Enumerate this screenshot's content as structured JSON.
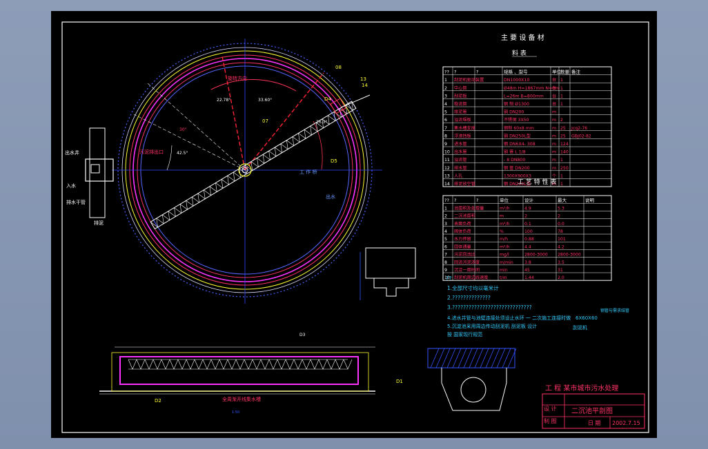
{
  "drawing": {
    "legend_labels": [
      "出水井",
      "入水",
      "排水干管",
      "排泥"
    ],
    "plan_labels": {
      "rotate_dir": "旋转方向",
      "sludge_outlet": "污泥排出口",
      "weir": "工 作 桥",
      "drain_pipe": "出水",
      "angle_a": "22.78°",
      "angle_b": "33.60°",
      "angle_c": "26.3°",
      "angle_d": "42.5°",
      "angle_e": "30°"
    },
    "callouts": [
      "08",
      "07",
      "D5",
      "D4",
      "D3",
      "D2",
      "D1",
      "14",
      "13",
      "15"
    ],
    "section_caption": "全周渐开线集水槽",
    "section_scale": "1:50"
  },
  "equipment_table": {
    "title": "主 要 设 备 材",
    "subtitle": "料 表",
    "headers": [
      "??",
      "?",
      "?",
      "规格 、型号",
      "单位",
      "数量",
      "备注"
    ],
    "rows": [
      [
        "1",
        "刮泥机驱动装置",
        "",
        "DN1000X10",
        "台",
        "1",
        ""
      ],
      [
        "2",
        "中心筒",
        "",
        "Ø48m H=1867mm N=0m",
        "台",
        "1",
        ""
      ],
      [
        "3",
        "刮泥板",
        "",
        "L=26m B=800mm",
        "台",
        "1",
        ""
      ],
      [
        "4",
        "稳流筒",
        "",
        "钢 制 Ø1300",
        "台",
        "1",
        ""
      ],
      [
        "5",
        "排泥管",
        "",
        "钢 DN200",
        "m",
        "",
        ""
      ],
      [
        "6",
        "溢流堰板",
        "",
        "不锈钢 3X50",
        "m",
        "2",
        ""
      ],
      [
        "7",
        "集水槽支座",
        "",
        "钢制 60x8 mm",
        "m",
        "25",
        "Jcq2-76"
      ],
      [
        "8",
        "浮渣挡板",
        "",
        "钢 DN250L型",
        "m",
        "25",
        "GBJ02-82"
      ],
      [
        "9",
        "进水管",
        "",
        "钢 DN6X4- 308",
        "m",
        "124",
        ""
      ],
      [
        "10",
        "出水管",
        "",
        "钢 管 L 1/8",
        "m",
        "140",
        ""
      ],
      [
        "11",
        "溢流管",
        "",
        "- 8 DN800",
        "m",
        "1",
        ""
      ],
      [
        "12",
        "排水管",
        "",
        "钢 管 DN200",
        "m",
        "250",
        ""
      ],
      [
        "13",
        "人孔",
        "",
        "1300X900X3",
        "个",
        "1",
        ""
      ],
      [
        "14",
        "排泥放空管",
        "",
        "钢 DN200L型",
        "m",
        "1",
        ""
      ]
    ]
  },
  "process_table": {
    "title": "工 艺 特 性 表",
    "headers": [
      "??",
      "?",
      "?",
      "单位",
      "设计",
      "最大",
      "说明"
    ],
    "rows": [
      [
        "1",
        "池面积及处理量",
        "",
        "m³/h",
        "4.9",
        "5.3",
        ""
      ],
      [
        "2",
        "二沉池面积",
        "",
        "m",
        "2",
        "2",
        ""
      ],
      [
        "3",
        "表面负荷",
        "",
        "m³/h",
        "0.1",
        "0.0",
        ""
      ],
      [
        "4",
        "固体负荷",
        "",
        "%",
        "100",
        "78",
        ""
      ],
      [
        "5",
        "水力停留",
        "",
        "m/h",
        "0.88",
        "101",
        ""
      ],
      [
        "6",
        "固体通量",
        "",
        "m²/h",
        "4.4",
        "4.2",
        ""
      ],
      [
        "7",
        "污泥回流比",
        "",
        "mg/l",
        "2800-3000",
        "2800-3000",
        ""
      ],
      [
        "8",
        "回流污泥浓度",
        "",
        "m/min",
        "3.8",
        "3.5",
        ""
      ],
      [
        "9",
        "沉淀一周时间",
        "",
        "min",
        "45",
        "31",
        ""
      ],
      [
        "10",
        "刮泥机周边线速度",
        "",
        "t/m",
        "1.44",
        "2.0",
        ""
      ]
    ]
  },
  "notes": {
    "heading": "??",
    "lines": [
      "1.全部尺寸均以毫米计",
      "2.??????????????",
      "3.?????????????????????????????",
      "4.进水井管与池壁连接处须设止水环 一 二次施工连接时做",
      "5.沉淀池采用周边传动刮泥机 刮泥板 设计",
      "按 国家现行规范"
    ],
    "side_note_a": "6X60X60",
    "side_note_b": "刮泥机",
    "side_note_c": "钢管与需求结管"
  },
  "title_block": {
    "project": "工 程 某市城市污水处理",
    "drawing_name": "二沉池平剖图",
    "label_designer": "设 计",
    "label_checker": "制 图",
    "label_date": "日 期",
    "date_value": "2002.7.15"
  }
}
